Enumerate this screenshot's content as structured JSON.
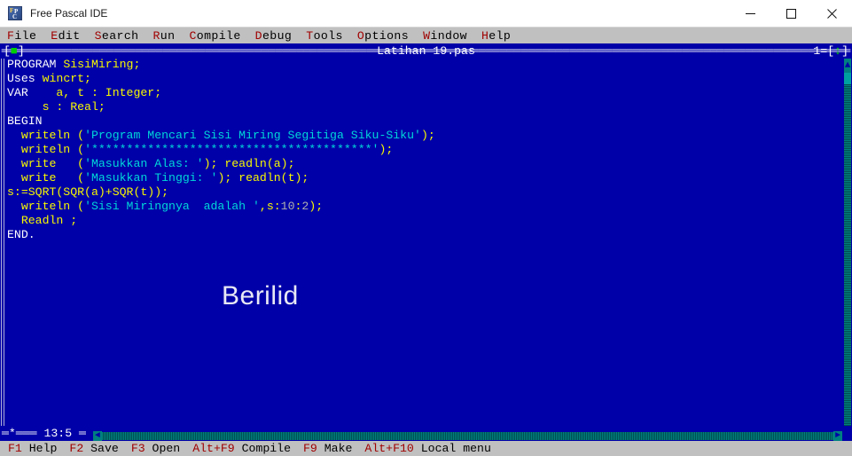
{
  "window": {
    "title": "Free Pascal IDE",
    "icon": "free-pascal-logo-icon",
    "controls": {
      "minimize": "—",
      "maximize": "□",
      "close": "✕"
    }
  },
  "menubar": {
    "items": [
      {
        "label": "File",
        "hotkey": "F"
      },
      {
        "label": "Edit",
        "hotkey": "E"
      },
      {
        "label": "Search",
        "hotkey": "S"
      },
      {
        "label": "Run",
        "hotkey": "R"
      },
      {
        "label": "Compile",
        "hotkey": "C"
      },
      {
        "label": "Debug",
        "hotkey": "D"
      },
      {
        "label": "Tools",
        "hotkey": "T"
      },
      {
        "label": "Options",
        "hotkey": "O"
      },
      {
        "label": "Window",
        "hotkey": "W"
      },
      {
        "label": "Help",
        "hotkey": "H"
      }
    ]
  },
  "editor": {
    "title": "Latihan 19.pas",
    "close_box": "[■]",
    "window_number": "1=[↕]",
    "modified_marker": "*",
    "cursor_position": "13:5",
    "scroll_up_arrow": "▲",
    "scroll_left_arrow": "◄",
    "scroll_right_arrow": "►",
    "watermark": "Berilid",
    "lines": [
      [
        {
          "t": "PROGRAM ",
          "c": "kw"
        },
        {
          "t": "SisiMiring;",
          "c": "id"
        }
      ],
      [
        {
          "t": "Uses ",
          "c": "kw"
        },
        {
          "t": "wincrt;",
          "c": "id"
        }
      ],
      [
        {
          "t": "VAR ",
          "c": "kw"
        },
        {
          "t": "   a, t : Integer;",
          "c": "id"
        }
      ],
      [
        {
          "t": "     s : Real;",
          "c": "id"
        }
      ],
      [
        {
          "t": "BEGIN",
          "c": "kw"
        }
      ],
      [
        {
          "t": "  writeln (",
          "c": "id"
        },
        {
          "t": "'Program Mencari Sisi Miring Segitiga Siku-Siku'",
          "c": "str"
        },
        {
          "t": ");",
          "c": "id"
        }
      ],
      [
        {
          "t": "  writeln (",
          "c": "id"
        },
        {
          "t": "'****************************************'",
          "c": "str"
        },
        {
          "t": ");",
          "c": "id"
        }
      ],
      [
        {
          "t": "  write   (",
          "c": "id"
        },
        {
          "t": "'Masukkan Alas: '",
          "c": "str"
        },
        {
          "t": "); readln(a);",
          "c": "id"
        }
      ],
      [
        {
          "t": "  write   (",
          "c": "id"
        },
        {
          "t": "'Masukkan Tinggi: '",
          "c": "str"
        },
        {
          "t": "); readln(t);",
          "c": "id"
        }
      ],
      [
        {
          "t": "s:=SQRT(SQR(a)+SQR(t));",
          "c": "id"
        }
      ],
      [
        {
          "t": "  writeln (",
          "c": "id"
        },
        {
          "t": "'Sisi Miringnya  adalah '",
          "c": "str"
        },
        {
          "t": ",s:",
          "c": "id"
        },
        {
          "t": "10",
          "c": "num"
        },
        {
          "t": ":",
          "c": "id"
        },
        {
          "t": "2",
          "c": "num"
        },
        {
          "t": ");",
          "c": "id"
        }
      ],
      [
        {
          "t": "  Readln ;",
          "c": "id"
        }
      ],
      [
        {
          "t": "END.",
          "c": "kw"
        }
      ]
    ]
  },
  "statusbar": {
    "items": [
      {
        "key": "F1",
        "label": "Help"
      },
      {
        "key": "F2",
        "label": "Save"
      },
      {
        "key": "F3",
        "label": "Open"
      },
      {
        "key": "Alt+F9",
        "label": "Compile"
      },
      {
        "key": "F9",
        "label": "Make"
      },
      {
        "key": "Alt+F10",
        "label": "Local menu"
      }
    ]
  },
  "colors": {
    "desktop_blue": "#0000a0",
    "editor_blue": "#0000a8",
    "menubar_gray": "#c0c0c0",
    "keyword_white": "#ffffff",
    "identifier_yellow": "#f8f800",
    "string_cyan": "#00d8d8",
    "number_gray": "#b0b0b0",
    "hotkey_red": "#a00000",
    "scrollbar_teal": "#008080"
  }
}
